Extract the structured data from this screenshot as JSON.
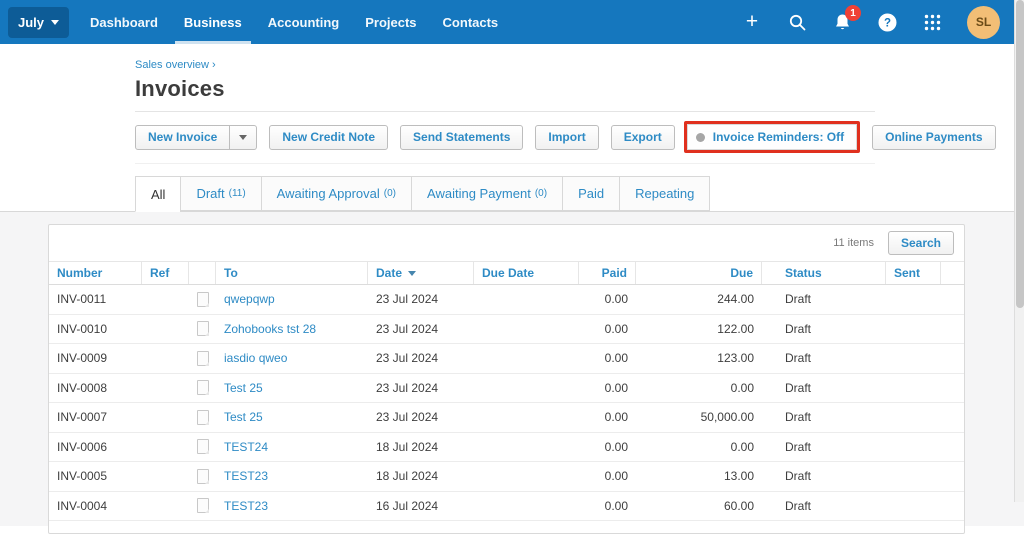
{
  "colors": {
    "navbar_blue": "#1577BE",
    "navbar_dark": "#0D5C97",
    "nav_underline": "#CFE2F0",
    "link_blue": "#2E8BC5",
    "badge_red": "#EF4136",
    "annotation_red": "#E0301E",
    "avatar_bg": "#F2BE76",
    "avatar_text": "#6B4B17"
  },
  "navbar": {
    "org_menu_label": "July",
    "items": [
      {
        "label": "Dashboard"
      },
      {
        "label": "Business"
      },
      {
        "label": "Accounting"
      },
      {
        "label": "Projects"
      },
      {
        "label": "Contacts"
      }
    ],
    "active_item": "Business",
    "right_icons": [
      "plus-icon",
      "search-icon",
      "notifications-icon",
      "help-icon",
      "apps-icon"
    ],
    "notification_count": "1",
    "help_glyph": "?",
    "avatar_initials": "SL"
  },
  "breadcrumb": {
    "label": "Sales overview",
    "separator": "›"
  },
  "page_title": "Invoices",
  "toolbar": {
    "new_invoice": "New Invoice",
    "new_credit_note": "New Credit Note",
    "send_statements": "Send Statements",
    "import": "Import",
    "export": "Export",
    "invoice_reminders": "Invoice Reminders: Off",
    "online_payments": "Online Payments"
  },
  "tabs": [
    {
      "label": "All",
      "count": "",
      "active": true
    },
    {
      "label": "Draft",
      "count": "(11)",
      "active": false
    },
    {
      "label": "Awaiting Approval",
      "count": "(0)",
      "active": false
    },
    {
      "label": "Awaiting Payment",
      "count": "(0)",
      "active": false
    },
    {
      "label": "Paid",
      "count": "",
      "active": false
    },
    {
      "label": "Repeating",
      "count": "",
      "active": false
    }
  ],
  "table": {
    "items_count": "11 items",
    "search_label": "Search",
    "columns": {
      "number": "Number",
      "ref": "Ref",
      "to": "To",
      "date": "Date",
      "due_date": "Due Date",
      "paid": "Paid",
      "due": "Due",
      "status": "Status",
      "sent": "Sent"
    },
    "sorted_by": "Date",
    "rows": [
      {
        "number": "INV-0011",
        "ref": "",
        "to": "qwepqwp",
        "date": "23 Jul 2024",
        "due_date": "",
        "paid": "0.00",
        "due": "244.00",
        "status": "Draft",
        "sent": ""
      },
      {
        "number": "INV-0010",
        "ref": "",
        "to": "Zohobooks tst 28",
        "date": "23 Jul 2024",
        "due_date": "",
        "paid": "0.00",
        "due": "122.00",
        "status": "Draft",
        "sent": ""
      },
      {
        "number": "INV-0009",
        "ref": "",
        "to": "iasdio qweo",
        "date": "23 Jul 2024",
        "due_date": "",
        "paid": "0.00",
        "due": "123.00",
        "status": "Draft",
        "sent": ""
      },
      {
        "number": "INV-0008",
        "ref": "",
        "to": "Test 25",
        "date": "23 Jul 2024",
        "due_date": "",
        "paid": "0.00",
        "due": "0.00",
        "status": "Draft",
        "sent": ""
      },
      {
        "number": "INV-0007",
        "ref": "",
        "to": "Test 25",
        "date": "23 Jul 2024",
        "due_date": "",
        "paid": "0.00",
        "due": "50,000.00",
        "status": "Draft",
        "sent": ""
      },
      {
        "number": "INV-0006",
        "ref": "",
        "to": "TEST24",
        "date": "18 Jul 2024",
        "due_date": "",
        "paid": "0.00",
        "due": "0.00",
        "status": "Draft",
        "sent": ""
      },
      {
        "number": "INV-0005",
        "ref": "",
        "to": "TEST23",
        "date": "18 Jul 2024",
        "due_date": "",
        "paid": "0.00",
        "due": "13.00",
        "status": "Draft",
        "sent": ""
      },
      {
        "number": "INV-0004",
        "ref": "",
        "to": "TEST23",
        "date": "16 Jul 2024",
        "due_date": "",
        "paid": "0.00",
        "due": "60.00",
        "status": "Draft",
        "sent": ""
      }
    ]
  }
}
